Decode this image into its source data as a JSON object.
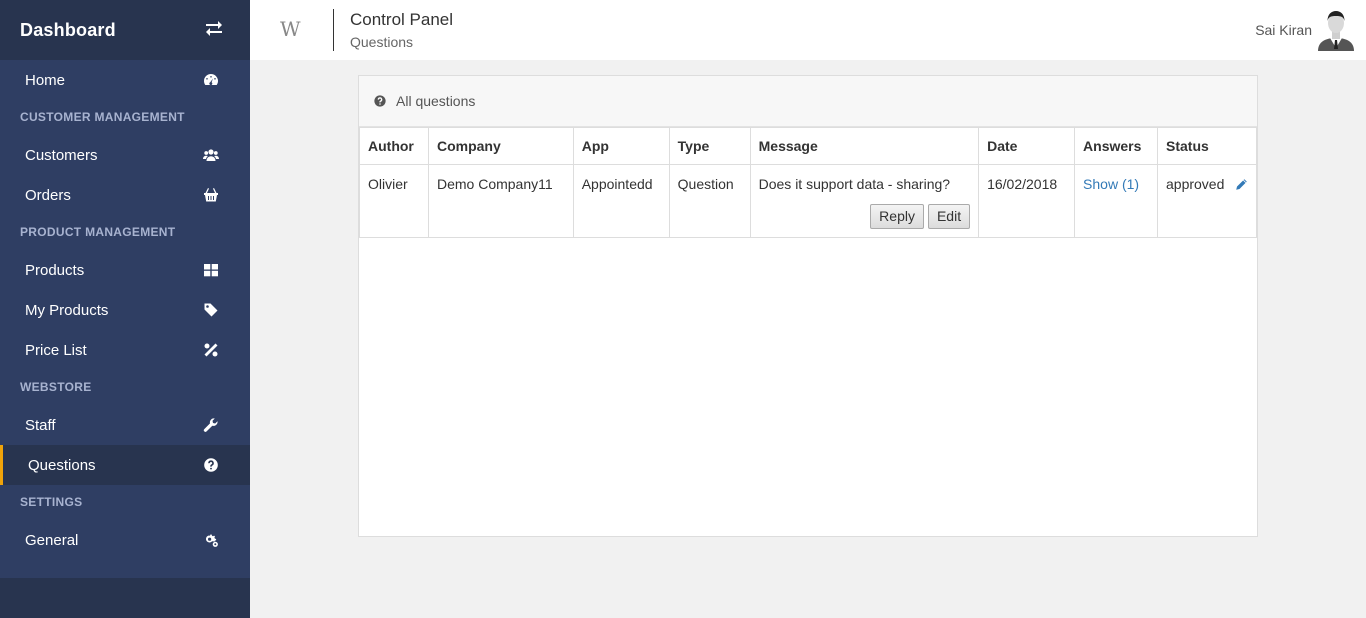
{
  "sidebar": {
    "title": "Dashboard",
    "toggle_icon": "exchange-arrows-icon",
    "items": {
      "home": {
        "label": "Home",
        "icon": "tachometer-icon"
      },
      "customers": {
        "label": "Customers",
        "icon": "users-icon"
      },
      "orders": {
        "label": "Orders",
        "icon": "shopping-basket-icon"
      },
      "products": {
        "label": "Products",
        "icon": "grid-icon"
      },
      "my_products": {
        "label": "My Products",
        "icon": "tag-icon"
      },
      "price_list": {
        "label": "Price List",
        "icon": "percent-icon"
      },
      "staff": {
        "label": "Staff",
        "icon": "wrench-icon"
      },
      "questions": {
        "label": "Questions",
        "icon": "question-circle-icon"
      },
      "general": {
        "label": "General",
        "icon": "cogs-icon"
      }
    },
    "sections": {
      "customer": "CUSTOMER MANAGEMENT",
      "product": "PRODUCT MANAGEMENT",
      "webstore": "WEBSTORE",
      "settings": "SETTINGS"
    },
    "active_item": "Questions",
    "active_color": "#f0a30a"
  },
  "header": {
    "logo": "W",
    "title": "Control Panel",
    "subtitle": "Questions",
    "user_name": "Sai Kiran"
  },
  "panel": {
    "heading": "All questions",
    "columns": [
      "Author",
      "Company",
      "App",
      "Type",
      "Message",
      "Date",
      "Answers",
      "Status"
    ],
    "rows": [
      {
        "author": "Olivier",
        "company": "Demo Company11",
        "app": "Appointedd",
        "type": "Question",
        "message": "Does it support data - sharing?",
        "reply_label": "Reply",
        "edit_label": "Edit",
        "date": "16/02/2018",
        "answers": "Show (1)",
        "status": "approved"
      }
    ]
  },
  "colors": {
    "sidebar_bg": "#2f3e63",
    "sidebar_header_bg": "#28344f",
    "link": "#337ab7"
  }
}
